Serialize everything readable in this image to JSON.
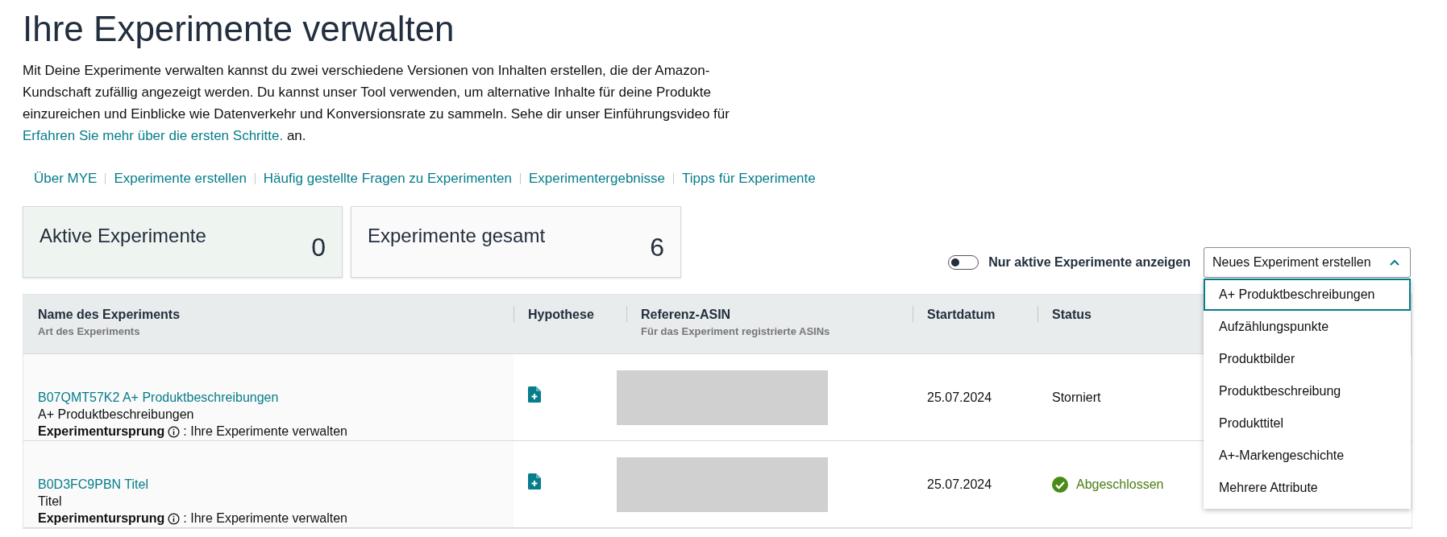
{
  "title": "Ihre Experimente verwalten",
  "intro": {
    "text": "Mit Deine Experimente verwalten kannst du zwei verschiedene Versionen von Inhalten erstellen, die der Amazon-Kundschaft zufällig angezeigt werden. Du kannst unser Tool verwenden, um alternative Inhalte für deine Produkte einzureichen und Einblicke wie Datenverkehr und Konversionsrate zu sammeln. Sehe dir unser Einführungsvideo für",
    "link": "Erfahren Sie mehr über die ersten Schritte.",
    "after": "an."
  },
  "nav_links": [
    "Über MYE",
    "Experimente erstellen",
    "Häufig gestellte Fragen zu Experimenten",
    "Experimentergebnisse",
    "Tipps für Experimente"
  ],
  "stats": [
    {
      "label": "Aktive Experimente",
      "value": "0",
      "selected": true
    },
    {
      "label": "Experimente gesamt",
      "value": "6",
      "selected": false
    }
  ],
  "filter_toggle": {
    "label": "Nur aktive Experimente anzeigen",
    "on": false
  },
  "create_dropdown": {
    "label": "Neues Experiment erstellen",
    "expanded": true,
    "options": [
      {
        "label": "A+ Produktbeschreibungen",
        "selected": true
      },
      {
        "label": "Aufzählungspunkte",
        "selected": false
      },
      {
        "label": "Produktbilder",
        "selected": false
      },
      {
        "label": "Produktbeschreibung",
        "selected": false
      },
      {
        "label": "Produkttitel",
        "selected": false
      },
      {
        "label": "A+-Markengeschichte",
        "selected": false
      },
      {
        "label": "Mehrere Attribute",
        "selected": false
      }
    ]
  },
  "table": {
    "columns": [
      {
        "label": "Name des Experiments",
        "sub": "Art des Experiments"
      },
      {
        "label": "Hypothese"
      },
      {
        "label": "Referenz-ASIN",
        "sub": "Für das Experiment registrierte ASINs"
      },
      {
        "label": "Startdatum"
      },
      {
        "label": "Status"
      }
    ],
    "rows": [
      {
        "name": "B07QMT57K2 A+ Produktbeschreibungen",
        "type": "A+ Produktbeschreibungen",
        "origin_label": "Experimentursprung",
        "origin": ": Ihre Experimente verwalten",
        "start": "25.07.2024",
        "status": "Storniert",
        "kind": "cancelled"
      },
      {
        "name": "B0D3FC9PBN Titel",
        "type": "Titel",
        "origin_label": "Experimentursprung",
        "origin": ": Ihre Experimente verwalten",
        "start": "25.07.2024",
        "status": "Abgeschlossen",
        "kind": "completed"
      }
    ]
  }
}
